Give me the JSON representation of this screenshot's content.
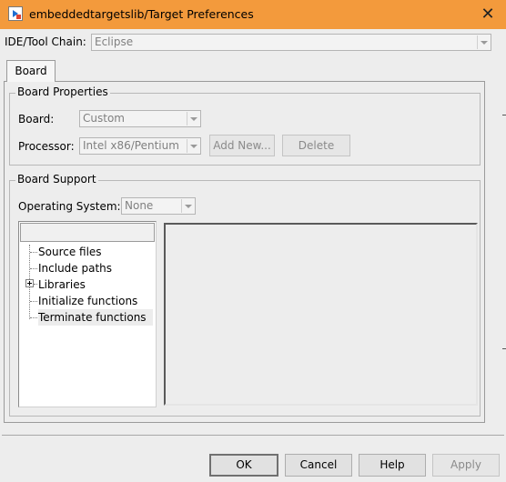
{
  "window": {
    "title": "embeddedtargetslib/Target Preferences",
    "close_glyph": "✕",
    "icon": "simulink-app-icon",
    "title_bar_color": "#f39a3c"
  },
  "toolchain": {
    "label": "IDE/Tool Chain:",
    "value": "Eclipse"
  },
  "tabs": [
    {
      "label": "Board",
      "selected": true
    }
  ],
  "board_properties": {
    "title": "Board Properties",
    "board_label": "Board:",
    "board_value": "Custom",
    "processor_label": "Processor:",
    "processor_value": "Intel x86/Pentium",
    "add_new_label": "Add New...",
    "delete_label": "Delete"
  },
  "board_support": {
    "title": "Board Support",
    "os_label": "Operating System:",
    "os_value": "None",
    "tree": [
      {
        "label": "Source files",
        "expandable": false
      },
      {
        "label": "Include paths",
        "expandable": false
      },
      {
        "label": "Libraries",
        "expandable": true
      },
      {
        "label": "Initialize functions",
        "expandable": false
      },
      {
        "label": "Terminate functions",
        "expandable": false,
        "selected": true
      }
    ]
  },
  "buttons": {
    "ok": "OK",
    "cancel": "Cancel",
    "help": "Help",
    "apply": "Apply"
  }
}
